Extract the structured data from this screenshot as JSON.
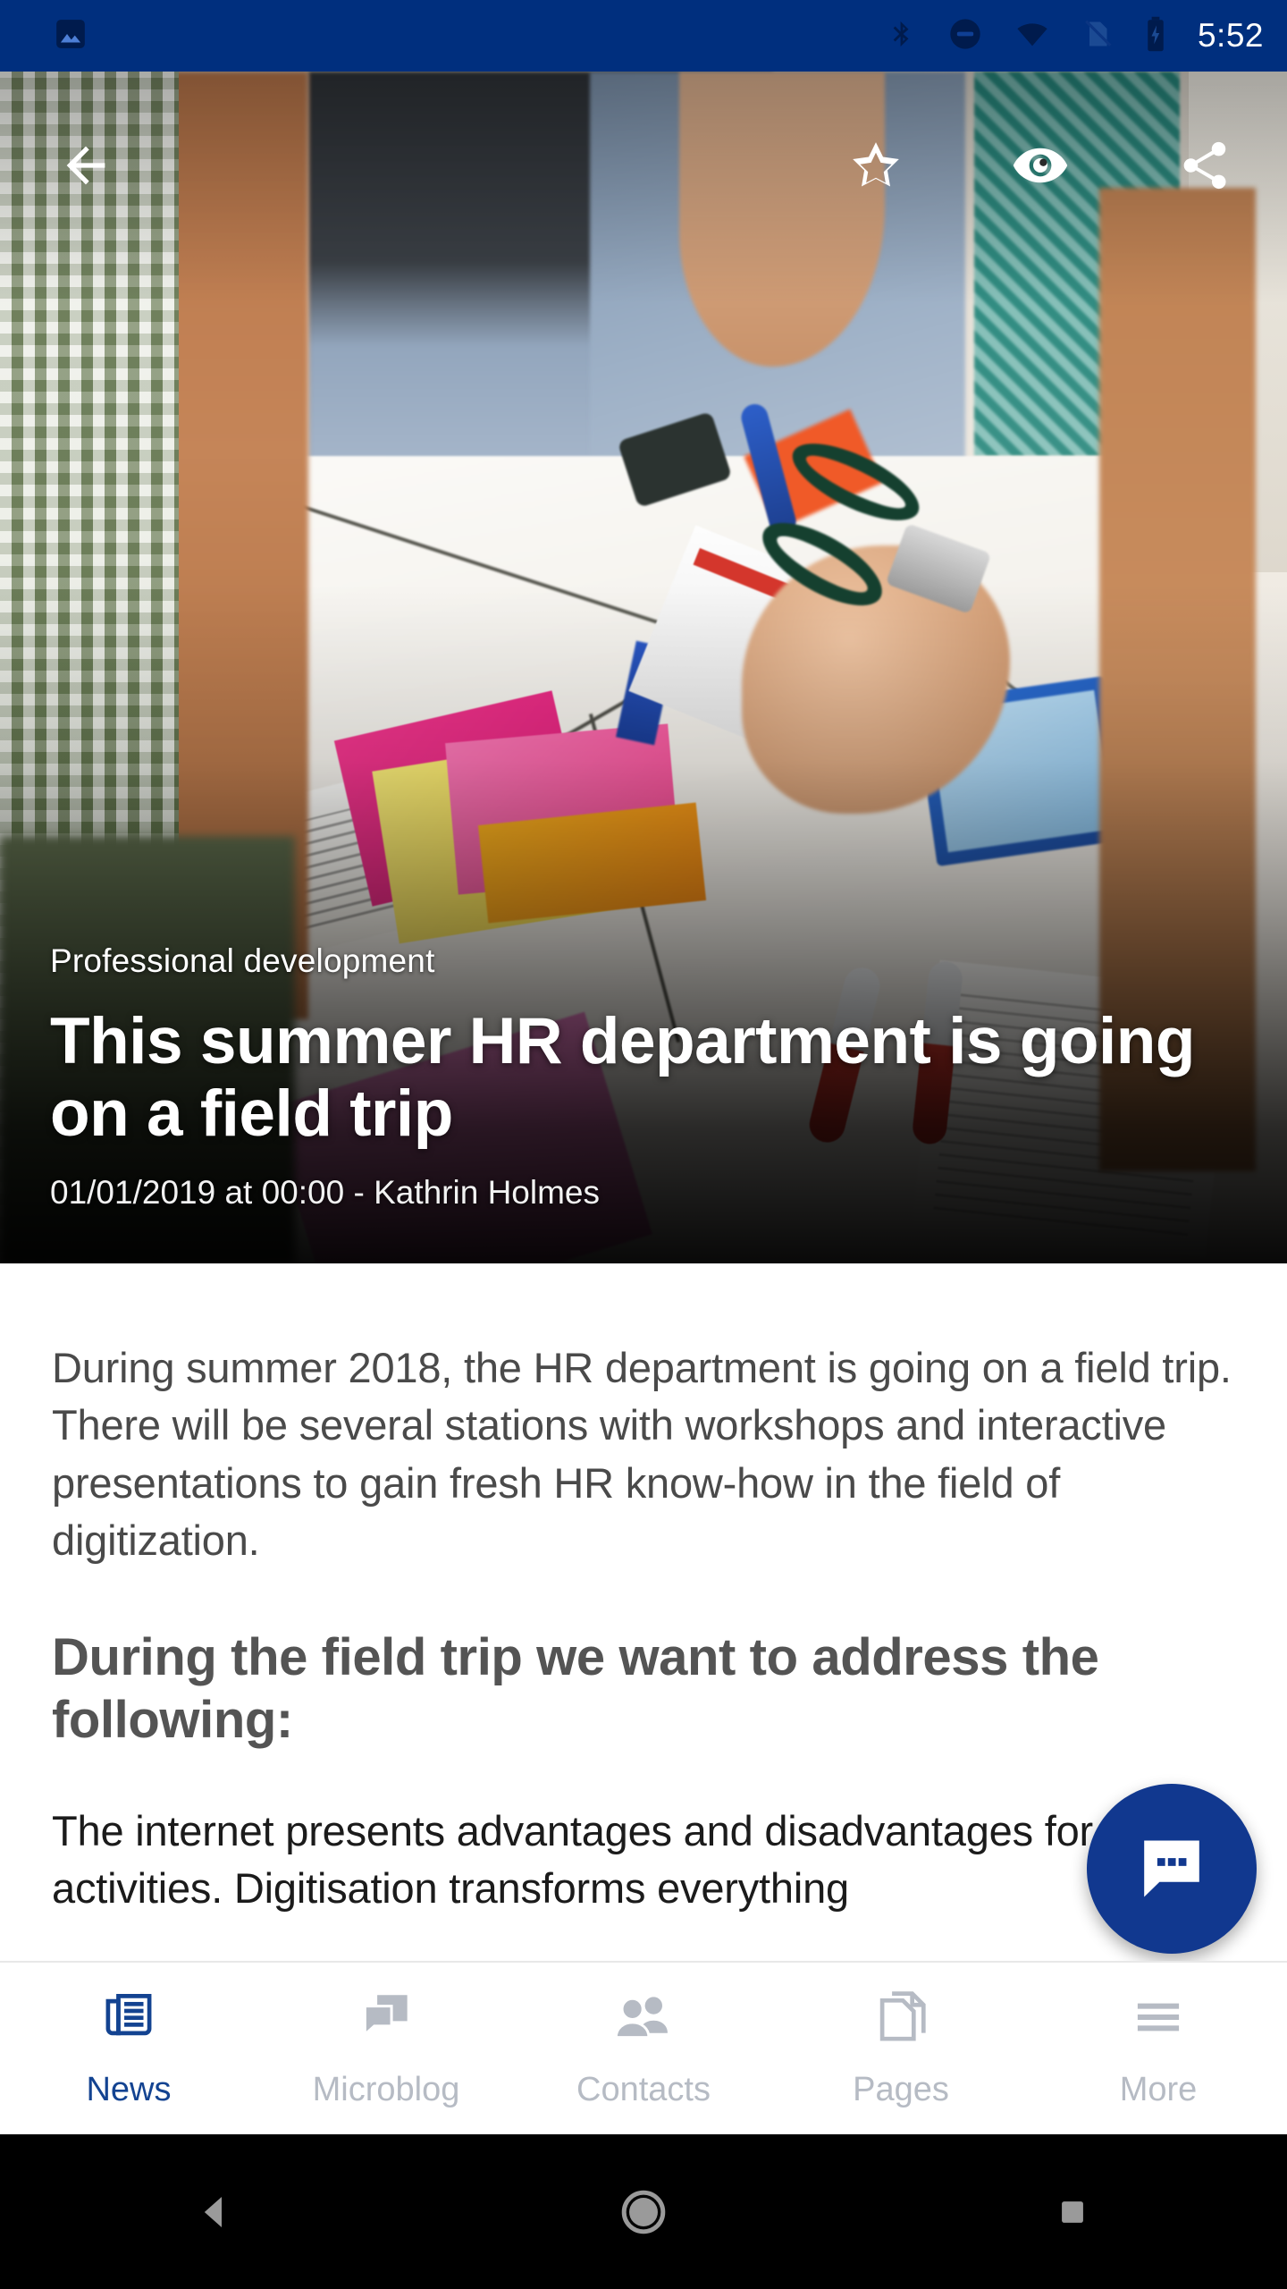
{
  "status_bar": {
    "time": "5:52",
    "background_color": "#002f7e",
    "left_icons": [
      "photo-notification-icon"
    ],
    "right_icons": [
      "bluetooth-icon",
      "do-not-disturb-icon",
      "wifi-icon",
      "sim-off-icon",
      "battery-charging-icon"
    ]
  },
  "app_bar": {
    "back_label": "back-arrow-icon",
    "actions": [
      {
        "name": "favorite-star-icon",
        "label": "Favorite"
      },
      {
        "name": "views-eye-icon",
        "label": "Views"
      },
      {
        "name": "share-icon",
        "label": "Share"
      }
    ]
  },
  "article": {
    "category": "Professional development",
    "headline": "This summer HR department is going on a field trip",
    "byline": "01/01/2019 at 00:00 -  Kathrin Holmes",
    "paragraph_1": "During summer 2018, the HR department is going on a field trip. There will be several stations with workshops and interactive presentations to gain fresh HR know-how in the field of digitization.",
    "subheading": "During the field trip we want to address the following:",
    "paragraph_2": "The internet presents advantages and disadvantages for HR activities. Digitisation transforms everything"
  },
  "fab": {
    "name": "comments-fab",
    "icon": "comment-dots-icon",
    "color": "#11388f"
  },
  "bottom_nav": {
    "active_color": "#134391",
    "inactive_color": "#b6bbc4",
    "items": [
      {
        "label": "News",
        "icon": "newspaper-icon",
        "active": true
      },
      {
        "label": "Microblog",
        "icon": "chat-bubbles-icon",
        "active": false
      },
      {
        "label": "Contacts",
        "icon": "people-icon",
        "active": false
      },
      {
        "label": "Pages",
        "icon": "pages-icon",
        "active": false
      },
      {
        "label": "More",
        "icon": "hamburger-menu-icon",
        "active": false
      }
    ]
  },
  "android_nav": {
    "buttons": [
      {
        "name": "android-back-button",
        "icon": "triangle-left-icon"
      },
      {
        "name": "android-home-button",
        "icon": "circle-icon"
      },
      {
        "name": "android-recents-button",
        "icon": "square-icon"
      }
    ]
  }
}
